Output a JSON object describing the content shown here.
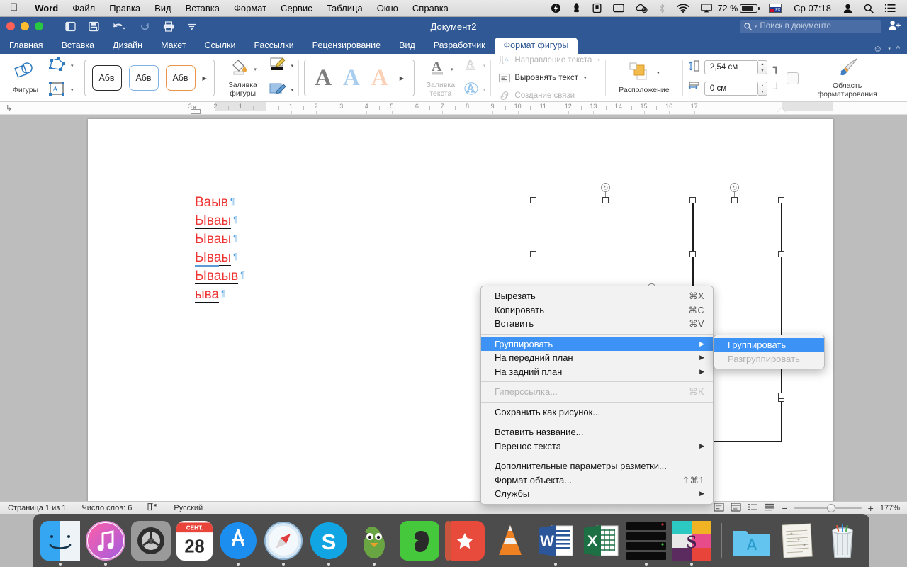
{
  "menubar": {
    "apple_icon": "apple-logo-icon",
    "items": [
      {
        "label": "Word",
        "bold": true
      },
      {
        "label": "Файл",
        "bold": false
      },
      {
        "label": "Правка",
        "bold": false
      },
      {
        "label": "Вид",
        "bold": false
      },
      {
        "label": "Вставка",
        "bold": false
      },
      {
        "label": "Формат",
        "bold": false
      },
      {
        "label": "Сервис",
        "bold": false
      },
      {
        "label": "Таблица",
        "bold": false
      },
      {
        "label": "Окно",
        "bold": false
      },
      {
        "label": "Справка",
        "bold": false
      }
    ],
    "status_icons": [
      "flash-icon",
      "rocket-icon",
      "bookmark-icon",
      "display-icon",
      "cloud-check-icon",
      "bluetooth-icon",
      "wifi-icon",
      "airplay-icon"
    ],
    "battery_percent": "72 %",
    "input_language": "РС",
    "clock": "Ср 07:18",
    "user_icon": "user-icon",
    "spotlight_icon": "search-icon",
    "notification_icon": "notification-center-icon"
  },
  "titlebar": {
    "document_title": "Документ2",
    "quick_access": [
      "sidebar-toggle-icon",
      "save-icon",
      "undo-icon",
      "redo-icon",
      "print-icon",
      "customize-icon"
    ],
    "search_placeholder": "Поиск в документе",
    "share_icon": "add-user-icon"
  },
  "ribbon_tabs": {
    "tabs": [
      {
        "label": "Главная",
        "active": false
      },
      {
        "label": "Вставка",
        "active": false
      },
      {
        "label": "Дизайн",
        "active": false
      },
      {
        "label": "Макет",
        "active": false
      },
      {
        "label": "Ссылки",
        "active": false
      },
      {
        "label": "Рассылки",
        "active": false
      },
      {
        "label": "Рецензирование",
        "active": false
      },
      {
        "label": "Вид",
        "active": false
      },
      {
        "label": "Разработчик",
        "active": false
      },
      {
        "label": "Формат фигуры",
        "active": true
      }
    ],
    "smiley_icon": "smiley-icon",
    "collapse_icon": "chevron-up-icon"
  },
  "ribbon": {
    "shapes_label": "Фигуры",
    "shapes_icon": "shapes-icon",
    "edit_points_icon": "edit-points-icon",
    "text_box_icon": "text-box-icon",
    "style_gallery": [
      {
        "label": "Абв",
        "variant": "k"
      },
      {
        "label": "Абв",
        "variant": "b"
      },
      {
        "label": "Абв",
        "variant": "o"
      }
    ],
    "shape_fill_label": "Заливка\nфигуры",
    "shape_fill_line1": "Заливка",
    "shape_fill_line2": "фигуры",
    "shape_fill_icon": "paint-bucket-icon",
    "shape_outline_icon": "pen-outline-icon",
    "shape_effects_icon": "shape-effects-icon",
    "text_gallery": [
      "A",
      "A",
      "A"
    ],
    "text_fill_line1": "Заливка",
    "text_fill_line2": "текста",
    "text_fill_icon": "text-fill-icon",
    "text_outline_icon": "text-outline-icon",
    "text_effects_icon": "text-effects-icon",
    "text_direction_label": "Направление текста",
    "text_direction_icon": "text-direction-icon",
    "align_text_label": "Выровнять текст",
    "align_text_icon": "align-text-icon",
    "create_link_label": "Создание связи",
    "create_link_icon": "link-icon",
    "arrange_label": "Расположение",
    "arrange_icon": "arrange-icon",
    "height_value": "2,54 см",
    "height_icon": "height-icon",
    "width_value": "0 см",
    "width_icon": "width-icon",
    "format_pane_line1": "Область",
    "format_pane_line2": "форматирования",
    "format_pane_icon": "brush-icon"
  },
  "ruler": {
    "labels_left": [
      "3",
      "2",
      "1"
    ],
    "labels_right": [
      "1",
      "2",
      "3",
      "4",
      "5",
      "6",
      "7",
      "8",
      "9",
      "10",
      "11",
      "12",
      "13",
      "14",
      "15",
      "16",
      "17"
    ]
  },
  "document": {
    "lines": [
      {
        "text": "Ваыв",
        "underline": true,
        "misspelled": true
      },
      {
        "text": "Ывaы",
        "underline": true,
        "misspelled": true
      },
      {
        "text": "Ывaы",
        "underline": true,
        "misspelled": true
      },
      {
        "text": "Ывaы",
        "underline": true,
        "misspelled": true
      },
      {
        "text": "Ывaыв",
        "underline": true,
        "misspelled": true
      },
      {
        "text": "ыва",
        "underline": true,
        "misspelled": true
      }
    ],
    "paragraph_mark": "¶"
  },
  "context_menu": {
    "items": [
      {
        "label": "Вырезать",
        "shortcut": "⌘X",
        "submenu": false,
        "selected": false,
        "disabled": false
      },
      {
        "label": "Копировать",
        "shortcut": "⌘C",
        "submenu": false,
        "selected": false,
        "disabled": false
      },
      {
        "label": "Вставить",
        "shortcut": "⌘V",
        "submenu": false,
        "selected": false,
        "disabled": false
      },
      {
        "separator": true
      },
      {
        "label": "Группировать",
        "shortcut": "",
        "submenu": true,
        "selected": true,
        "disabled": false
      },
      {
        "label": "На передний план",
        "shortcut": "",
        "submenu": true,
        "selected": false,
        "disabled": false
      },
      {
        "label": "На задний план",
        "shortcut": "",
        "submenu": true,
        "selected": false,
        "disabled": false
      },
      {
        "separator": true
      },
      {
        "label": "Гиперссылка...",
        "shortcut": "⌘K",
        "submenu": false,
        "selected": false,
        "disabled": true
      },
      {
        "separator": true
      },
      {
        "label": "Сохранить как рисунок...",
        "shortcut": "",
        "submenu": false,
        "selected": false,
        "disabled": false
      },
      {
        "separator": true
      },
      {
        "label": "Вставить название...",
        "shortcut": "",
        "submenu": false,
        "selected": false,
        "disabled": false
      },
      {
        "label": "Перенос текста",
        "shortcut": "",
        "submenu": true,
        "selected": false,
        "disabled": false
      },
      {
        "separator": true
      },
      {
        "label": "Дополнительные параметры разметки...",
        "shortcut": "",
        "submenu": false,
        "selected": false,
        "disabled": false
      },
      {
        "label": "Формат объекта...",
        "shortcut": "⇧⌘1",
        "submenu": false,
        "selected": false,
        "disabled": false
      },
      {
        "label": "Службы",
        "shortcut": "",
        "submenu": true,
        "selected": false,
        "disabled": false
      }
    ]
  },
  "submenu": {
    "items": [
      {
        "label": "Группировать",
        "selected": true,
        "disabled": false
      },
      {
        "label": "Разгруппировать",
        "selected": false,
        "disabled": true
      }
    ]
  },
  "statusbar": {
    "page": "Страница 1 из 1",
    "words": "Число слов: 6",
    "proofing_icon": "proofing-icon",
    "language": "Русский",
    "view_icons": [
      "print-layout-icon",
      "web-layout-icon",
      "outline-icon",
      "draft-icon"
    ],
    "zoom_out": "−",
    "zoom_in": "+",
    "zoom_level": "177%"
  },
  "dock": {
    "items": [
      {
        "name": "finder",
        "running": true
      },
      {
        "name": "itunes",
        "running": true
      },
      {
        "name": "system-preferences",
        "running": false
      },
      {
        "name": "calendar",
        "running": false,
        "month": "СЕНТ.",
        "day": "28"
      },
      {
        "name": "app-store",
        "running": true
      },
      {
        "name": "safari",
        "running": true
      },
      {
        "name": "skype",
        "running": true
      },
      {
        "name": "duck-downloader",
        "running": false
      },
      {
        "name": "evernote",
        "running": false
      },
      {
        "name": "wunderlist",
        "running": false
      },
      {
        "name": "vlc",
        "running": false
      },
      {
        "name": "word",
        "running": true
      },
      {
        "name": "excel",
        "running": false
      },
      {
        "name": "terminal",
        "running": true
      },
      {
        "name": "sublime",
        "running": true
      }
    ],
    "stack_items": [
      {
        "name": "applications-folder"
      },
      {
        "name": "documents-stack"
      },
      {
        "name": "trash"
      }
    ]
  }
}
